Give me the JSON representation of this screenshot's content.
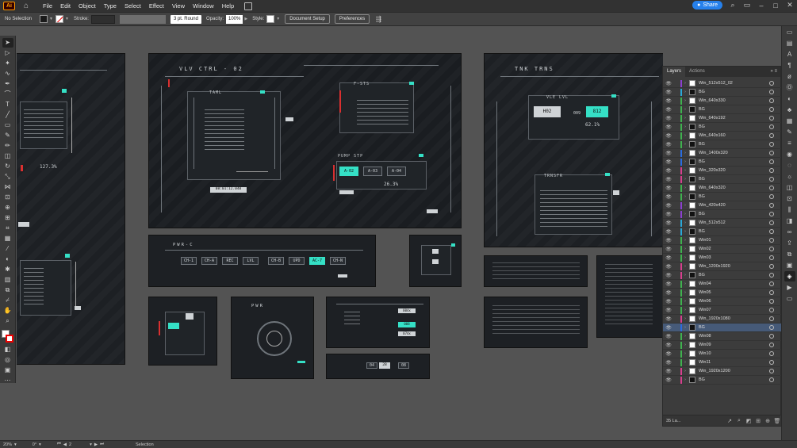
{
  "menubar": {
    "logo": "Ai",
    "items": [
      "File",
      "Edit",
      "Object",
      "Type",
      "Select",
      "Effect",
      "View",
      "Window",
      "Help"
    ],
    "share_label": "Share"
  },
  "control": {
    "selection": "No Selection",
    "stroke_label": "Stroke:",
    "brush": "3 pt. Round",
    "opacity_label": "Opacity:",
    "opacity_value": "100%",
    "style_label": "Style:",
    "doc_setup": "Document Setup",
    "preferences": "Preferences"
  },
  "artboards": {
    "vlv_title": "VLV CTRL - 02",
    "tank_title": "TNK TRNS",
    "fsts": "F-STS",
    "taml": "TAML",
    "pump": "PUMP STP",
    "pump_btns": [
      "A-02",
      "A-03",
      "A-04"
    ],
    "pump_pct": "26.3%",
    "time": "08:01:12.040",
    "pct_left": "127.3%",
    "vle_lvl": "VLE LVL",
    "vle_vals": [
      "H02",
      "009",
      "812"
    ],
    "vle_pct": "62.1%",
    "transfer": "TRNSFR",
    "pwr_c": "PWR-C",
    "pwr_btns": [
      "CH-1",
      "CH-A",
      "REC",
      "LVL",
      "CH-B",
      "UPD",
      "AC-7",
      "CH-N"
    ],
    "pwr": "PWR",
    "small_vals": [
      "004x",
      "008",
      "074x"
    ],
    "bottom_vals": [
      "04",
      "2B",
      "08"
    ]
  },
  "layers_panel": {
    "tabs": [
      "Layers",
      "Actions"
    ],
    "count": "35 La...",
    "layers": [
      {
        "name": "Win_512x512_02",
        "color": "#8b3fd0",
        "thumb": "light"
      },
      {
        "name": "BG",
        "color": "#2aa8d8",
        "thumb": "dark"
      },
      {
        "name": "Win_640x330",
        "color": "#3fb24f",
        "thumb": "light"
      },
      {
        "name": "BG",
        "color": "#3fb24f",
        "thumb": "dark"
      },
      {
        "name": "Win_640x192",
        "color": "#3fb24f",
        "thumb": "light"
      },
      {
        "name": "BG",
        "color": "#3fb24f",
        "thumb": "dark"
      },
      {
        "name": "Win_640x160",
        "color": "#3fb24f",
        "thumb": "light"
      },
      {
        "name": "BG",
        "color": "#3fb24f",
        "thumb": "dark"
      },
      {
        "name": "Win_1400x320",
        "color": "#2a6ce0",
        "thumb": "light"
      },
      {
        "name": "BG",
        "color": "#2a6ce0",
        "thumb": "dark"
      },
      {
        "name": "Win_320x320",
        "color": "#d83f8f",
        "thumb": "light"
      },
      {
        "name": "BG",
        "color": "#d83f8f",
        "thumb": "dark"
      },
      {
        "name": "Win_640x320",
        "color": "#3fb24f",
        "thumb": "light"
      },
      {
        "name": "BG",
        "color": "#3fb24f",
        "thumb": "dark"
      },
      {
        "name": "Win_420x420",
        "color": "#8b3fd0",
        "thumb": "light"
      },
      {
        "name": "BG",
        "color": "#8b3fd0",
        "thumb": "dark"
      },
      {
        "name": "Win_512x512",
        "color": "#2aa8d8",
        "thumb": "light"
      },
      {
        "name": "BG",
        "color": "#2aa8d8",
        "thumb": "dark"
      },
      {
        "name": "Win01",
        "color": "#3fb24f",
        "thumb": "light"
      },
      {
        "name": "Win02",
        "color": "#3fb24f",
        "thumb": "light"
      },
      {
        "name": "Win03",
        "color": "#3fb24f",
        "thumb": "light"
      },
      {
        "name": "Win_1200x1920",
        "color": "#d83f8f",
        "thumb": "light"
      },
      {
        "name": "BG",
        "color": "#d83f8f",
        "thumb": "dark"
      },
      {
        "name": "Win04",
        "color": "#3fb24f",
        "thumb": "light"
      },
      {
        "name": "Win05",
        "color": "#3fb24f",
        "thumb": "light"
      },
      {
        "name": "Win06",
        "color": "#3fb24f",
        "thumb": "light"
      },
      {
        "name": "Win07",
        "color": "#3fb24f",
        "thumb": "light"
      },
      {
        "name": "Win_1920x1080",
        "color": "#d83f8f",
        "thumb": "light"
      },
      {
        "name": "BG",
        "color": "#2a6ce0",
        "thumb": "dark",
        "selected": true
      },
      {
        "name": "Win08",
        "color": "#3fb24f",
        "thumb": "light"
      },
      {
        "name": "Win09",
        "color": "#3fb24f",
        "thumb": "light"
      },
      {
        "name": "Win10",
        "color": "#3fb24f",
        "thumb": "light"
      },
      {
        "name": "Win11",
        "color": "#3fb24f",
        "thumb": "light"
      },
      {
        "name": "Win_1920x1200",
        "color": "#d83f8f",
        "thumb": "light"
      },
      {
        "name": "BG",
        "color": "#d83f8f",
        "thumb": "dark"
      }
    ]
  },
  "status": {
    "zoom": "20%",
    "rotation": "0°",
    "artboard_num": "2",
    "mode": "Selection"
  }
}
